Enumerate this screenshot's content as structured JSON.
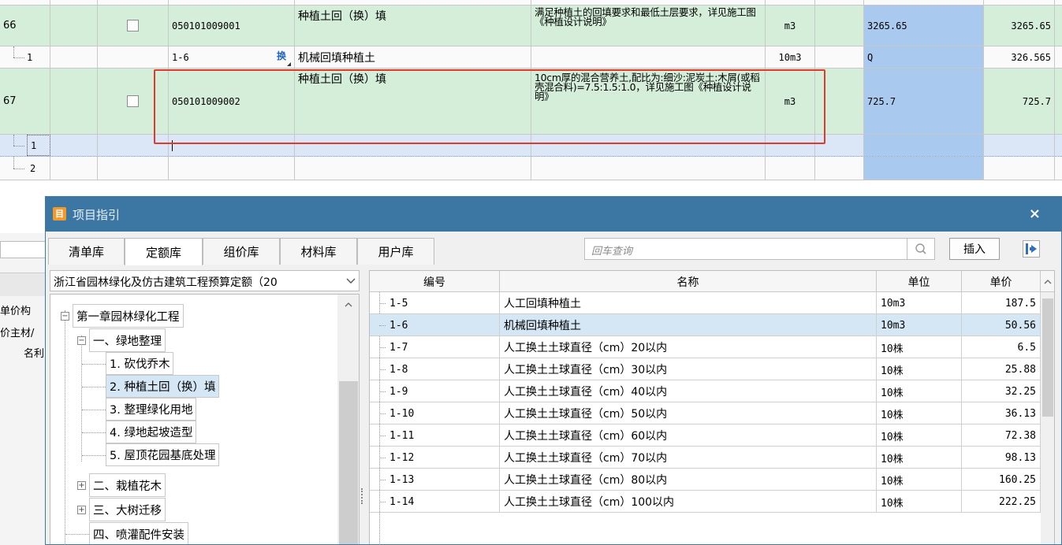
{
  "bill_rows": [
    {
      "seq": "66",
      "code": "050101009001",
      "name": "种植土回（换）填",
      "feature": "满足种植土的回填要求和最低土层要求，详见施工图《种植设计说明》",
      "unit": "m3",
      "quantity": "3265.65",
      "amount": "3265.65"
    },
    {
      "seq": "1",
      "code": "1-6",
      "swap": "换",
      "name": "机械回填种植土",
      "feature": "",
      "unit": "10m3",
      "quantity": "Q",
      "amount": "326.565"
    },
    {
      "seq": "67",
      "code": "050101009002",
      "name": "种植土回（换）填",
      "feature": "10cm厚的混合营养土,配比为:细沙:泥炭土:木屑(或稻壳混合料)=7.5:1.5:1.0，详见施工图《种植设计说明》",
      "unit": "m3",
      "quantity": "725.7",
      "amount": "725.7"
    },
    {
      "seq": "1"
    },
    {
      "seq": "2"
    }
  ],
  "background_panel": {
    "label1": "单价构",
    "label2": "价主材/",
    "label3": "名利"
  },
  "dialog": {
    "title": "项目指引",
    "close": "×",
    "tabs": [
      "清单库",
      "定额库",
      "组价库",
      "材料库",
      "用户库"
    ],
    "active_tab": 1,
    "search_placeholder": "回车查询",
    "insert_label": "插入",
    "library": "浙江省园林绿化及仿古建筑工程预算定额（20",
    "tree": [
      {
        "label": "第一章园林绿化工程",
        "expander": "−"
      },
      {
        "label": "一、绿地整理",
        "expander": "−"
      },
      {
        "label": "1. 砍伐乔木"
      },
      {
        "label": "2. 种植土回（换）填",
        "selected": true
      },
      {
        "label": "3. 整理绿化用地"
      },
      {
        "label": "4. 绿地起坡造型"
      },
      {
        "label": "5. 屋顶花园基底处理"
      },
      {
        "label": "二、栽植花木",
        "expander": "+"
      },
      {
        "label": "三、大树迁移",
        "expander": "+"
      },
      {
        "label": "四、喷灌配件安装"
      }
    ],
    "table": {
      "headers": [
        "编号",
        "名称",
        "单位",
        "单价"
      ],
      "rows": [
        [
          "1-5",
          "人工回填种植土",
          "10m3",
          "187.5"
        ],
        [
          "1-6",
          "机械回填种植土",
          "10m3",
          "50.56"
        ],
        [
          "1-7",
          "人工换土土球直径（cm）20以内",
          "10株",
          "6.5"
        ],
        [
          "1-8",
          "人工换土土球直径（cm）30以内",
          "10株",
          "25.88"
        ],
        [
          "1-9",
          "人工换土土球直径（cm）40以内",
          "10株",
          "32.25"
        ],
        [
          "1-10",
          "人工换土土球直径（cm）50以内",
          "10株",
          "36.13"
        ],
        [
          "1-11",
          "人工换土土球直径（cm）60以内",
          "10株",
          "72.38"
        ],
        [
          "1-12",
          "人工换土土球直径（cm）70以内",
          "10株",
          "98.13"
        ],
        [
          "1-13",
          "人工换土土球直径（cm）80以内",
          "10株",
          "160.25"
        ],
        [
          "1-14",
          "人工换土土球直径（cm）100以内",
          "10株",
          "222.25"
        ]
      ],
      "selected_row": 1
    }
  },
  "colors": {
    "bill_green": "#d4eed9",
    "quantity_blue": "#a9c9ef",
    "title_bar": "#3c77a4",
    "selection": "#d5e6f5",
    "highlight_box": "#e03a2e"
  }
}
